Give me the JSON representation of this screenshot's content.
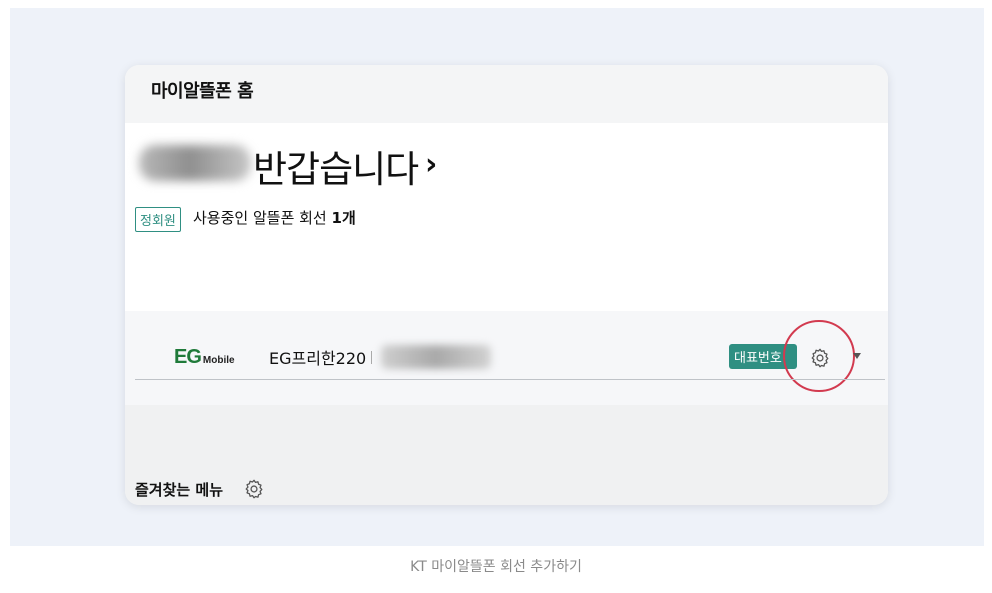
{
  "page": {
    "title": "마이알뜰폰 홈",
    "greeting": "반갑습니다",
    "greeting_chevron": "›",
    "member_badge": "정회원",
    "line_count_prefix": "사용중인 알뜰폰 회선",
    "line_count_value": "1개"
  },
  "line": {
    "brand_main": "EG",
    "brand_sub": "Mobile",
    "plan_name": "EG프리한220",
    "primary_badge": "대표번호"
  },
  "favorites": {
    "title": "즐겨찾는 메뉴"
  },
  "caption": "KT 마이알뜰폰 회선 추가하기",
  "colors": {
    "accent_teal": "#2f8f82",
    "highlight_red": "#d23a4f",
    "brand_green": "#1f7a3a"
  },
  "icons": {
    "line_settings": "gear-icon",
    "expand": "caret-down-icon",
    "favorites_settings": "gear-icon"
  }
}
